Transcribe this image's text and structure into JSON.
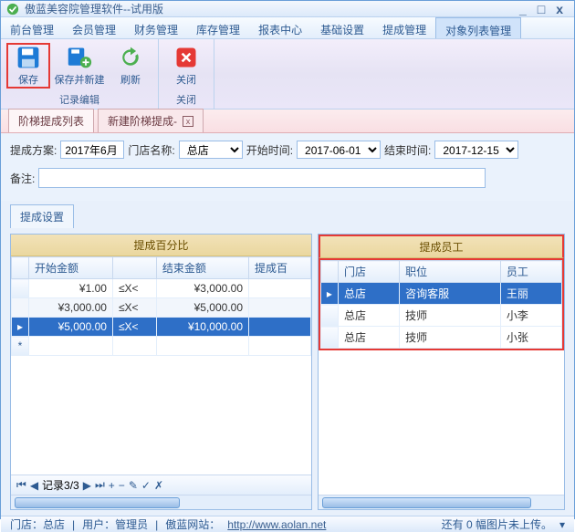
{
  "window": {
    "title": "傲蓝美容院管理软件--试用版"
  },
  "menus": [
    "前台管理",
    "会员管理",
    "财务管理",
    "库存管理",
    "报表中心",
    "基础设置",
    "提成管理",
    "对象列表管理"
  ],
  "menus_active_index": 7,
  "ribbon": {
    "group1": {
      "label": "记录编辑",
      "save": "保存",
      "save_new": "保存并新建",
      "refresh": "刷新"
    },
    "group2": {
      "label": "关闭",
      "close": "关闭"
    }
  },
  "doc_tabs": [
    {
      "label": "阶梯提成列表",
      "closable": false,
      "active": true
    },
    {
      "label": "新建阶梯提成-",
      "closable": true,
      "active": false
    }
  ],
  "form": {
    "plan_label": "提成方案:",
    "plan_value": "2017年6月",
    "store_label": "门店名称:",
    "store_value": "总店",
    "start_label": "开始时间:",
    "start_value": "2017-06-01",
    "end_label": "结束时间:",
    "end_value": "2017-12-15",
    "remark_label": "备注:",
    "remark_value": ""
  },
  "sub_tab": "提成设置",
  "left_grid": {
    "title": "提成百分比",
    "cols": [
      "开始金额",
      "",
      "结束金额",
      "提成百"
    ],
    "rows": [
      {
        "a": "¥1.00",
        "op": "≤X<",
        "b": "¥3,000.00"
      },
      {
        "a": "¥3,000.00",
        "op": "≤X<",
        "b": "¥5,000.00"
      },
      {
        "a": "¥5,000.00",
        "op": "≤X<",
        "b": "¥10,000.00"
      }
    ],
    "selected_index": 2,
    "pager": "记录3/3"
  },
  "right_grid": {
    "title": "提成员工",
    "cols": [
      "门店",
      "职位",
      "员工"
    ],
    "rows": [
      {
        "store": "总店",
        "role": "咨询客服",
        "emp": "王丽"
      },
      {
        "store": "总店",
        "role": "技师",
        "emp": "小李"
      },
      {
        "store": "总店",
        "role": "技师",
        "emp": "小张"
      }
    ],
    "selected_index": 0
  },
  "status": {
    "store": "门店：总店",
    "user": "用户：管理员",
    "link_label": "傲蓝网站：",
    "link_url": "http://www.aolan.net",
    "right": "还有 0 幅图片未上传。"
  }
}
